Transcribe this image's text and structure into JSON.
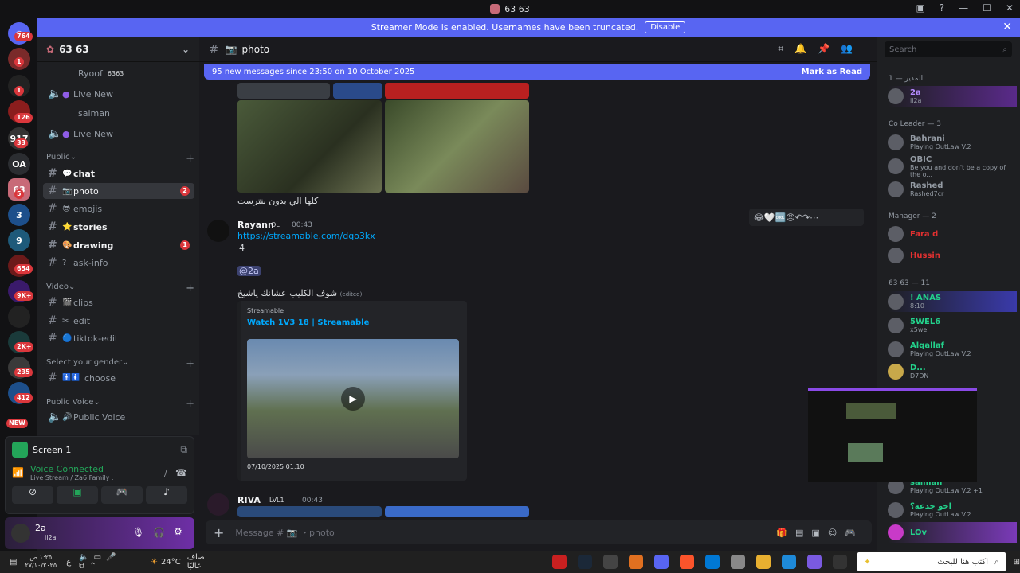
{
  "window": {
    "title": "63 63"
  },
  "banner": {
    "text": "Streamer Mode is enabled. Usernames have been truncated.",
    "disable": "Disable"
  },
  "guild_badges": [
    "764",
    "1",
    "1",
    "126",
    "33",
    "OA",
    "5",
    "1",
    "1",
    "654",
    "9K+",
    "2K+",
    "235",
    "412",
    "NEW"
  ],
  "server": {
    "name": "63 63"
  },
  "voice_top": [
    {
      "name": "Ryoof",
      "tag": "6363"
    },
    {
      "name": "Live New"
    },
    {
      "name": "salman"
    },
    {
      "name": "Live New"
    }
  ],
  "categories": {
    "public": "Public",
    "video": "Video",
    "gender": "Select your gender",
    "public_voice": "Public Voice"
  },
  "channels": [
    {
      "name": "chat",
      "icon": "💬"
    },
    {
      "name": "photo",
      "icon": "📷",
      "badge": "2"
    },
    {
      "name": "emojis",
      "icon": "😎"
    },
    {
      "name": "stories",
      "icon": "⭐"
    },
    {
      "name": "drawing",
      "icon": "🎨",
      "badge": "1"
    },
    {
      "name": "ask-info",
      "icon": "?"
    },
    {
      "name": "clips",
      "icon": "🎬"
    },
    {
      "name": "edit",
      "icon": "✂"
    },
    {
      "name": "tiktok-edit",
      "icon": "🔵"
    },
    {
      "name": "choose",
      "icon": "🚹🚺"
    },
    {
      "name": "Public Voice",
      "icon": "🔊"
    }
  ],
  "voice_panel": {
    "screen": "Screen 1",
    "status": "Voice Connected",
    "detail": "Live Stream / Za6 Family ."
  },
  "user": {
    "name": "2a",
    "tag": "ii2a"
  },
  "channel_header": {
    "name": "photo"
  },
  "new_messages": {
    "text": "95 new messages since 23:50 on 10 October 2025",
    "mark": "Mark as Read"
  },
  "messages": {
    "caption1": "كلها الي بدون بنترست",
    "author": "Rayann",
    "author_tag": "OL",
    "time": "00:43",
    "link": "https://streamable.com/dqo3kx",
    "line2": "4",
    "mention": "@2a",
    "arabic": "شوف الكليب عشانك ياشيخ",
    "edited": "(edited)",
    "embed_provider": "Streamable",
    "embed_title": "Watch 1V3 18 | Streamable",
    "embed_date": "07/10/2025 01:10",
    "next_author": "RIVA",
    "next_tag": "LVL1",
    "next_time": "00:43"
  },
  "composer": {
    "placeholder": "Message # 📷 ・photo"
  },
  "members": {
    "search": "Search",
    "groups": [
      {
        "label": "المدير — 1",
        "items": [
          {
            "name": "2a",
            "sub": "ii2a"
          }
        ]
      },
      {
        "label": "Co Leader — 3",
        "items": [
          {
            "name": "Bahrani",
            "sub": "Playing OutLaw V.2"
          },
          {
            "name": "OBIC",
            "sub": "Be you and don't be a copy of the o..."
          },
          {
            "name": "Rashed",
            "sub": "Rashed7cr"
          }
        ]
      },
      {
        "label": "Manager — 2",
        "items": [
          {
            "name": "Fara d",
            "sub": ""
          },
          {
            "name": "Hussin",
            "sub": ""
          }
        ]
      },
      {
        "label": "63 63 — 11",
        "items": [
          {
            "name": "! ANAS",
            "sub": "8:10"
          },
          {
            "name": "5WEL6",
            "sub": "x5we"
          },
          {
            "name": "Alqallaf",
            "sub": "Playing OutLaw V.2"
          },
          {
            "name": "D...",
            "sub": "D7DN"
          }
        ]
      }
    ],
    "bottom": [
      {
        "name": "salman",
        "sub": "Playing OutLaw V.2 +1"
      },
      {
        "name": "اخو جدعه؟",
        "sub": "Playing OutLaw V.2"
      },
      {
        "name": "LOv",
        "sub": ""
      }
    ]
  },
  "taskbar": {
    "time": "١:٢٥ ص",
    "date": "٢٧/١٠/٢٠٢٥",
    "lang": "ع",
    "weather": "24°C",
    "weather_text": "صاف غالبًا",
    "search": "اكتب هنا للبحث"
  }
}
